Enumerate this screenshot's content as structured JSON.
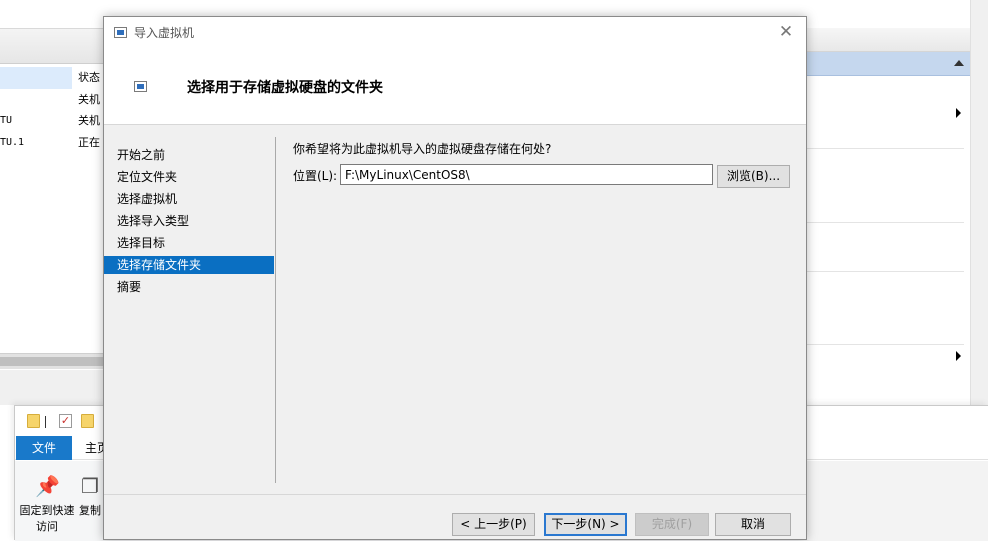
{
  "background_app": {
    "columns": {
      "state_header": "状态"
    },
    "vm_rows": [
      {
        "name": "",
        "state": "关机"
      },
      {
        "name": "TU",
        "state": "关机"
      },
      {
        "name": "TU.1",
        "state": "正在"
      }
    ]
  },
  "file_explorer": {
    "tabs": {
      "file": "文件",
      "home": "主页"
    },
    "ribbon": {
      "pin_label": "固定到快速访问",
      "copy_label": "复制"
    }
  },
  "dialog": {
    "title": "导入虚拟机",
    "close_glyph": "✕",
    "header_title": "选择用于存储虚拟硬盘的文件夹",
    "nav_items": [
      {
        "label": "开始之前",
        "active": false
      },
      {
        "label": "定位文件夹",
        "active": false
      },
      {
        "label": "选择虚拟机",
        "active": false
      },
      {
        "label": "选择导入类型",
        "active": false
      },
      {
        "label": "选择目标",
        "active": false
      },
      {
        "label": "选择存储文件夹",
        "active": true
      },
      {
        "label": "摘要",
        "active": false
      }
    ],
    "question": "你希望将为此虚拟机导入的虚拟硬盘存储在何处?",
    "location_label": "位置(L):",
    "location_value": "F:\\MyLinux\\CentOS8\\",
    "browse_button": "浏览(B)...",
    "buttons": {
      "prev": "< 上一步(P)",
      "next": "下一步(N) >",
      "finish": "完成(F)",
      "cancel": "取消"
    }
  },
  "colors": {
    "accent": "#0a6fc2",
    "file_tab": "#1979ca",
    "actions_header": "#c5d7ee"
  }
}
